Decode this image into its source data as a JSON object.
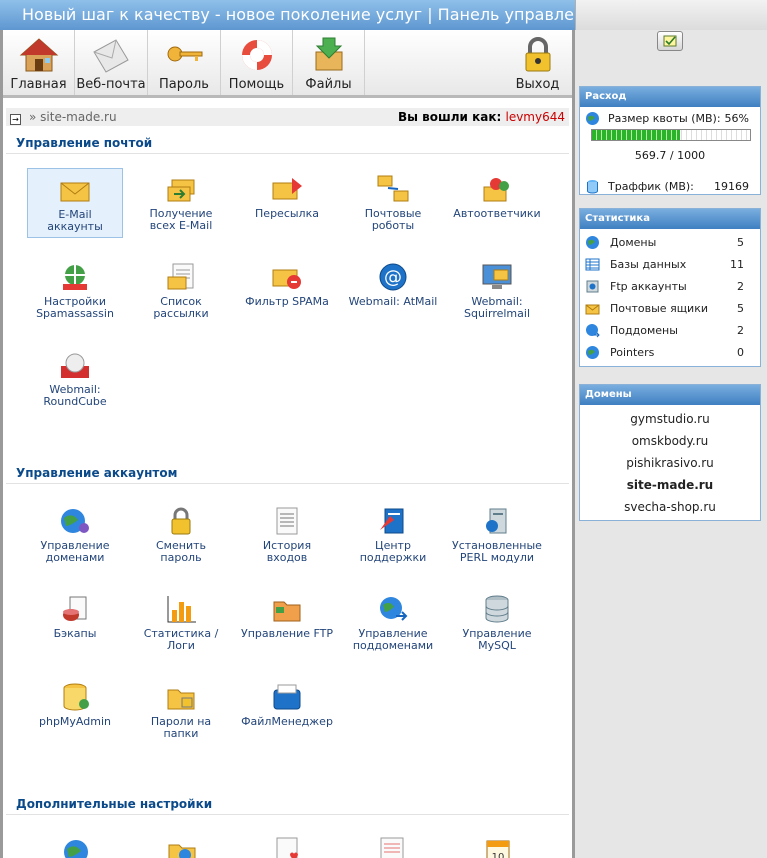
{
  "header": {
    "title": "Новый шаг к качеству - новое поколение услуг | Панель управления"
  },
  "toolbar": {
    "home": "Главная",
    "webmail": "Веб-почта",
    "password": "Пароль",
    "help": "Помощь",
    "files": "Файлы",
    "logout": "Выход"
  },
  "breadcrumb": {
    "path": "» site-made.ru",
    "logged_in": "Вы вошли как:",
    "user": "levmy644"
  },
  "mail": {
    "title": "Управление почтой",
    "items": [
      "E-Mail аккаунты",
      "Получение всех E-Mail",
      "Пересылка",
      "Почтовые роботы",
      "Автоответчики",
      "Настройки Spamassassin",
      "Список рассылки",
      "Фильтр SPAMа",
      "Webmail: AtMail",
      "Webmail: Squirrelmail",
      "Webmail: RoundCube"
    ]
  },
  "account": {
    "title": "Управление аккаунтом",
    "items": [
      "Управление доменами",
      "Сменить пароль",
      "История входов",
      "Центр поддержки",
      "Установленные PERL модули",
      "Бэкапы",
      "Статистика / Логи",
      "Управление FTP",
      "Управление поддоменами",
      "Управление MySQL",
      "phpMyAdmin",
      "Пароли на папки",
      "ФайлМенеджер"
    ]
  },
  "extra": {
    "title": "Дополнительные настройки"
  },
  "usage": {
    "title": "Расход",
    "quota_label": "Размер квоты (MB):",
    "quota_percent": "56%",
    "quota_fraction": 0.56,
    "quota_value": "569.7 / 1000",
    "traffic_label": "Траффик (MB):",
    "traffic_value": "19169"
  },
  "stats": {
    "title": "Статистика",
    "rows": [
      {
        "label": "Домены",
        "value": "5"
      },
      {
        "label": "Базы данных",
        "value": "11"
      },
      {
        "label": "Ftp аккаунты",
        "value": "2"
      },
      {
        "label": "Почтовые ящики",
        "value": "5"
      },
      {
        "label": "Поддомены",
        "value": "2"
      },
      {
        "label": "Pointers",
        "value": "0"
      }
    ]
  },
  "domains": {
    "title": "Домены",
    "list": [
      "gymstudio.ru",
      "omskbody.ru",
      "pishikrasivo.ru",
      "site-made.ru",
      "svecha-shop.ru"
    ]
  }
}
